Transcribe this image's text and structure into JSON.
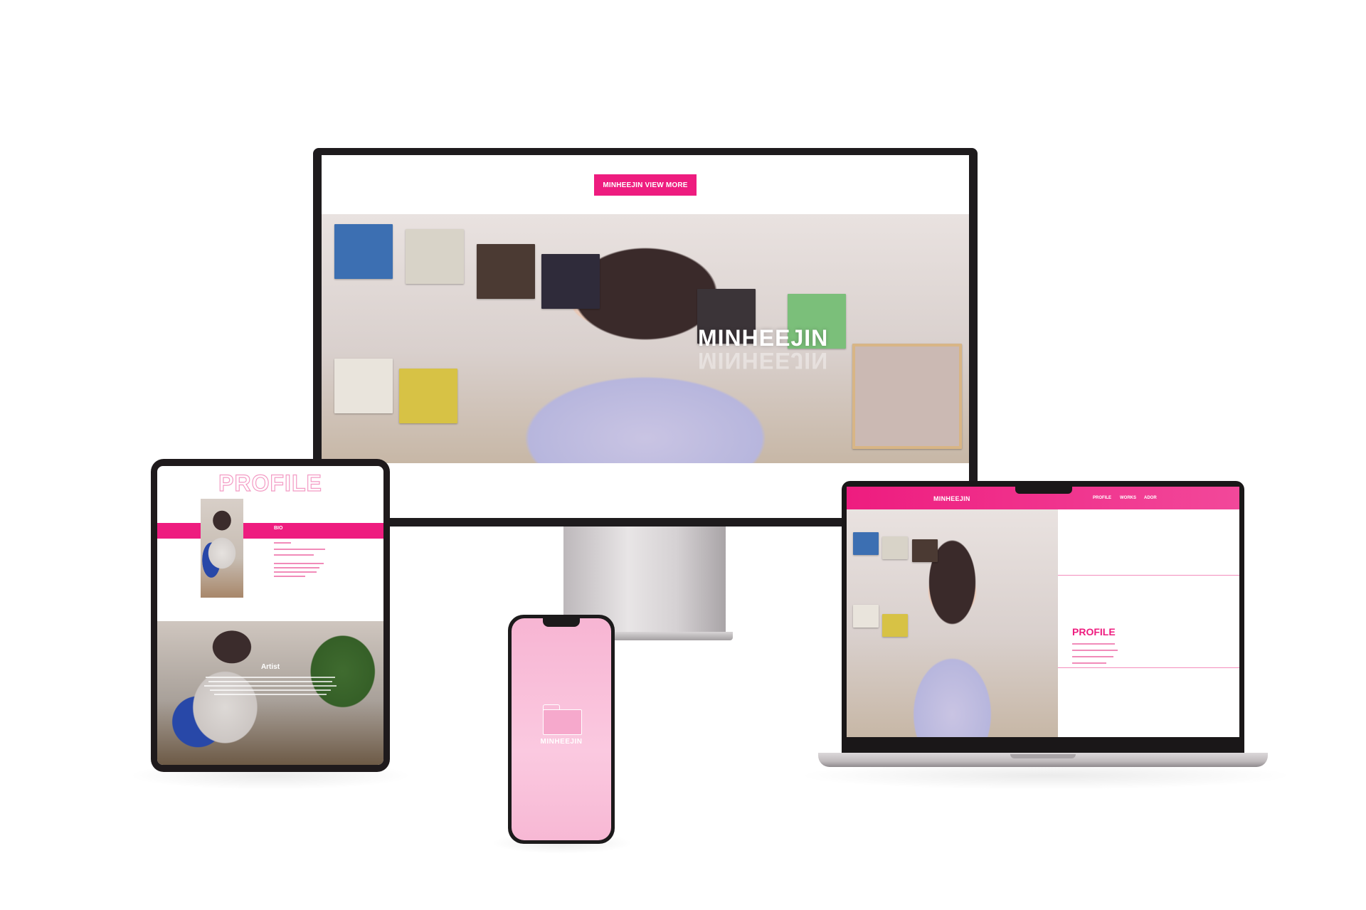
{
  "monitor": {
    "view_more_button": "MINHEEJIN VIEW MORE",
    "hero_title": "MINHEEJIN"
  },
  "tablet": {
    "profile_heading": "PROFILE",
    "bio_label": "BIO",
    "artist_title": "Artist"
  },
  "phone": {
    "folder_label": "MINHEEJIN",
    "folder_icon": "folder-icon"
  },
  "laptop": {
    "logo": "MINHEEJIN",
    "nav": [
      "PROFILE",
      "WORKS",
      "ADOR"
    ],
    "profile_title": "PROFILE"
  },
  "colors": {
    "accent": "#ee1c7f",
    "accent_light": "#f7b5d3"
  }
}
